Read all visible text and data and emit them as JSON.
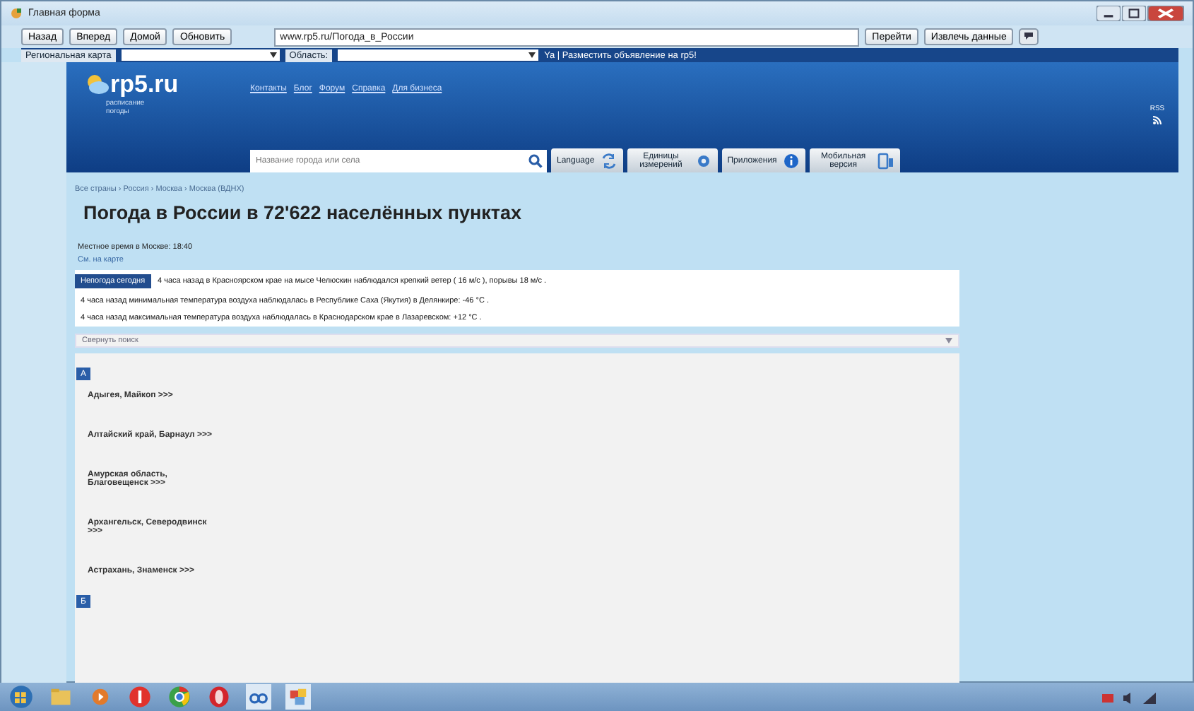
{
  "window": {
    "title": "Главная форма"
  },
  "toolbar": {
    "buttons": [
      "Назад",
      "Вперед",
      "Домой",
      "Обновить"
    ],
    "url": "www.rp5.ru/Погода_в_России",
    "go_button": "Перейти",
    "extract_button": "Извлечь данные"
  },
  "filter_bar": {
    "label": "Региональная карта",
    "region_label": "Область:",
    "notice": "Ya | Разместить объявление на rp5!"
  },
  "site": {
    "logo": "rp5.ru",
    "logo_caption": "расписание погоды",
    "menu_links": [
      "Контакты",
      "Блог",
      "Форум",
      "Справка",
      "Для бизнеса"
    ],
    "rss_label": "RSS",
    "search": {
      "placeholder": "Название города или села"
    },
    "tools": [
      {
        "label": "Language"
      },
      {
        "label": "Единицы измерений"
      },
      {
        "label": "Приложения"
      },
      {
        "label": "Мобильная версия"
      }
    ],
    "breadcrumbs": "Все страны › Россия › Москва › Москва (ВДНХ)",
    "heading": "Погода в России в 72'622 населённых пунктах",
    "local_time": "Местное время в Москве: 18:40",
    "map_link": "См. на карте",
    "news": {
      "badge": "Непогода сегодня",
      "items": [
        "4 часа назад в Красноярском крае на мысе Челюскин наблюдался крепкий ветер ( 16 м/с ), порывы 18 м/с .",
        "4 часа назад минимальная температура воздуха наблюдалась в Республике Саха (Якутия) в Делянкире: -46 °C .",
        "4 часа назад максимальная температура воздуха наблюдалась в Краснодарском крае в Лазаревском: +12 °C ."
      ]
    },
    "collapse_label": "Свернуть поиск",
    "letters": [
      {
        "letter": "А",
        "entries": [
          "Адыгея, Майкоп >>>",
          "Алтайский край, Барнаул >>>",
          "Амурская область, Благовещенск >>>",
          "Архангельск, Северодвинск >>>",
          "Астрахань, Знаменск >>>"
        ]
      },
      {
        "letter": "Б"
      }
    ]
  }
}
